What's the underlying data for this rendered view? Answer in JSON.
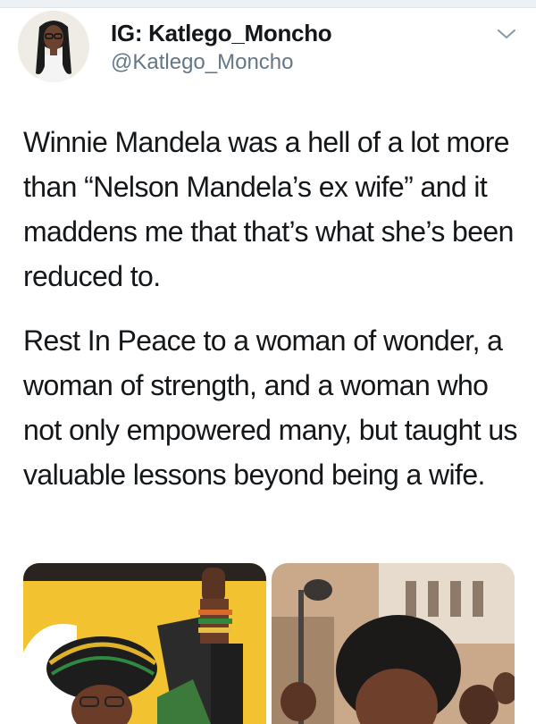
{
  "tweet": {
    "author": {
      "display_name": "IG: Katlego_Moncho",
      "handle": "@Katlego_Moncho",
      "avatar_icon": "profile-photo"
    },
    "menu_icon": "chevron-down-icon",
    "paragraphs": [
      "Winnie Mandela was a hell of a lot more than “Nelson Mandela’s ex wife” and it maddens me that that’s what she’s been reduced to.",
      "Rest In Peace to a woman of wonder, a woman of strength, and a woman who not only empowered many, but taught us valuable lessons beyond being a wife."
    ],
    "media": [
      {
        "name": "photo-raised-fist",
        "accent": "#f2c230"
      },
      {
        "name": "photo-crowd",
        "accent": "#c9a98a"
      }
    ]
  },
  "colors": {
    "text": "#14171a",
    "secondary": "#657786",
    "border": "#e1e8ed"
  }
}
